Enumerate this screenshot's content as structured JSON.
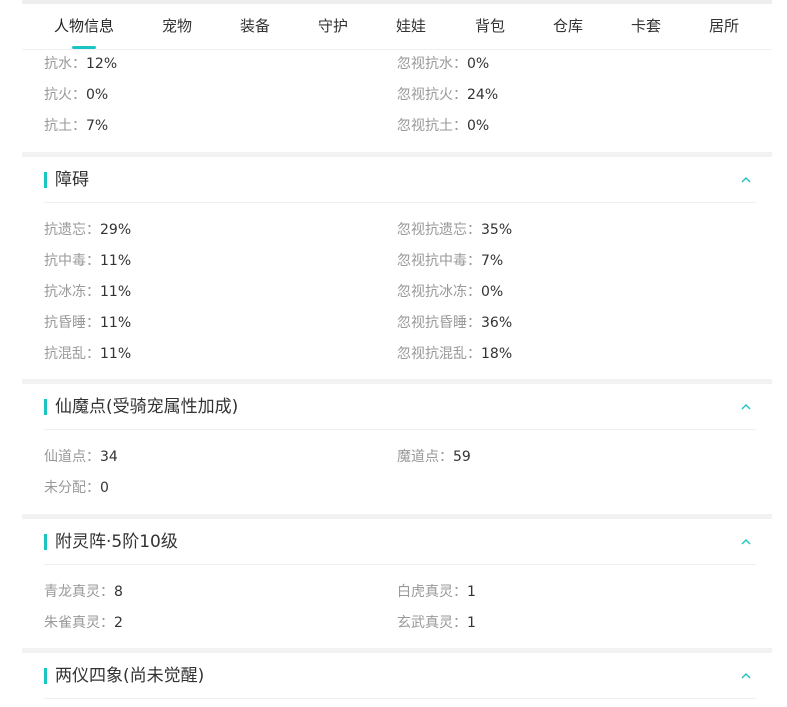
{
  "tabs": [
    {
      "label": "人物信息",
      "active": true
    },
    {
      "label": "宠物"
    },
    {
      "label": "装备"
    },
    {
      "label": "守护"
    },
    {
      "label": "娃娃"
    },
    {
      "label": "背包"
    },
    {
      "label": "仓库"
    },
    {
      "label": "卡套"
    },
    {
      "label": "居所"
    }
  ],
  "accent_color": "#1cc5c5",
  "resist_elements": {
    "rows": [
      {
        "left": {
          "label": "抗水：",
          "value": "12%"
        },
        "right": {
          "label": "忽视抗水：",
          "value": "0%"
        }
      },
      {
        "left": {
          "label": "抗火：",
          "value": "0%"
        },
        "right": {
          "label": "忽视抗火：",
          "value": "24%"
        }
      },
      {
        "left": {
          "label": "抗土：",
          "value": "7%"
        },
        "right": {
          "label": "忽视抗土：",
          "value": "0%"
        }
      }
    ]
  },
  "sections": [
    {
      "title": "障碍",
      "icon": "chevron-up-icon",
      "rows": [
        {
          "left": {
            "label": "抗遗忘：",
            "value": "29%"
          },
          "right": {
            "label": "忽视抗遗忘：",
            "value": "35%"
          }
        },
        {
          "left": {
            "label": "抗中毒：",
            "value": "11%"
          },
          "right": {
            "label": "忽视抗中毒：",
            "value": "7%"
          }
        },
        {
          "left": {
            "label": "抗冰冻：",
            "value": "11%"
          },
          "right": {
            "label": "忽视抗冰冻：",
            "value": "0%"
          }
        },
        {
          "left": {
            "label": "抗昏睡：",
            "value": "11%"
          },
          "right": {
            "label": "忽视抗昏睡：",
            "value": "36%"
          }
        },
        {
          "left": {
            "label": "抗混乱：",
            "value": "11%"
          },
          "right": {
            "label": "忽视抗混乱：",
            "value": "18%"
          }
        }
      ]
    },
    {
      "title": "仙魔点(受骑宠属性加成)",
      "icon": "chevron-up-icon",
      "rows": [
        {
          "left": {
            "label": "仙道点：",
            "value": "34"
          },
          "right": {
            "label": "魔道点：",
            "value": "59"
          }
        },
        {
          "left": {
            "label": "未分配：",
            "value": "0"
          }
        }
      ]
    },
    {
      "title": "附灵阵·5阶10级",
      "icon": "chevron-up-icon",
      "rows": [
        {
          "left": {
            "label": "青龙真灵：",
            "value": "8"
          },
          "right": {
            "label": "白虎真灵：",
            "value": "1"
          }
        },
        {
          "left": {
            "label": "朱雀真灵：",
            "value": "2"
          },
          "right": {
            "label": "玄武真灵：",
            "value": "1"
          }
        }
      ]
    },
    {
      "title": "两仪四象(尚未觉醒)",
      "icon": "chevron-up-icon",
      "rows": []
    }
  ]
}
